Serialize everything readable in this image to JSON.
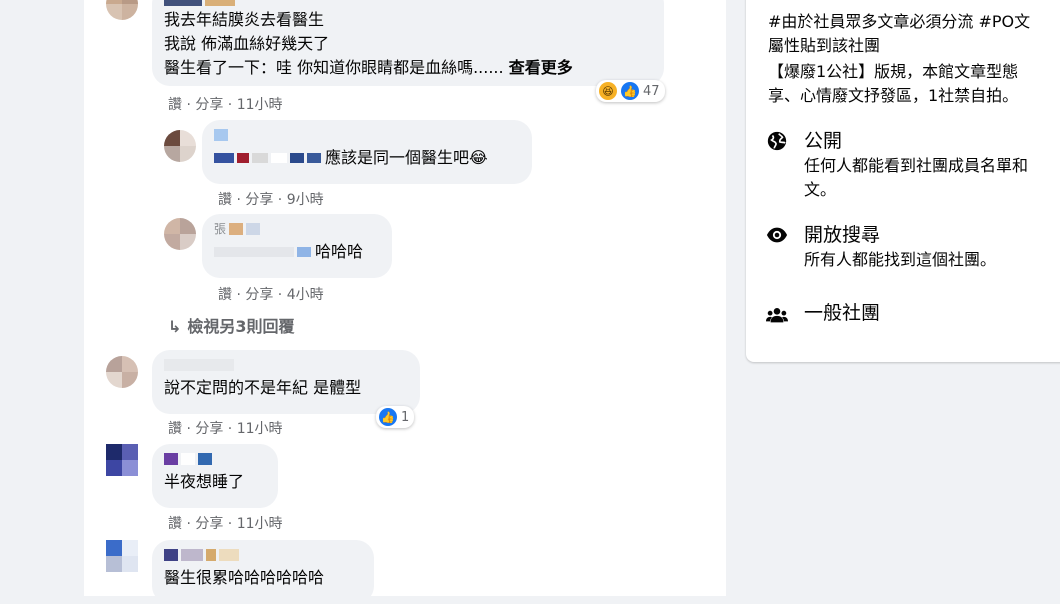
{
  "comments": [
    {
      "lines": [
        "我去年結膜炎去看醫生",
        "我說 佈滿血絲好幾天了",
        "醫生看了一下：哇 你知道你眼睛都是血絲嗎......"
      ],
      "see_more": "查看更多",
      "actions": "讚 · 分享 · 11小時",
      "reaction_count": "47"
    },
    {
      "text": "應該是同一個醫生吧",
      "emoji": "😂",
      "actions": "讚 · 分享 · 9小時"
    },
    {
      "name_hint": "張",
      "text": "哈哈哈",
      "actions": "讚 · 分享 · 4小時"
    },
    {
      "text": "說不定問的不是年紀 是體型",
      "actions": "讚 · 分享 · 11小時",
      "reaction_count": "1"
    },
    {
      "text": "半夜想睡了",
      "actions": "讚 · 分享 · 11小時"
    },
    {
      "text": "醫生很累哈哈哈哈哈哈"
    }
  ],
  "more_replies": "檢視另3則回覆",
  "about": {
    "desc_lines": [
      "#由於社員眾多文章必須分流 #PO文",
      "屬性貼到該社團",
      "【爆廢1公社】版規，本館文章型態",
      "享、心情廢文抒發區，1社禁自拍。"
    ],
    "public_title": "公開",
    "public_desc_1": "任何人都能看到社團成員名單和",
    "public_desc_2": "文。",
    "visible_title": "開放搜尋",
    "visible_desc": "所有人都能找到這個社團。",
    "general_title": "一般社團"
  },
  "colors": {
    "accent": "#1877f2",
    "bubble": "#f0f2f5",
    "muted": "#65676b"
  },
  "icons": {
    "public": "globe-icon",
    "visible": "eye-icon",
    "general": "people-icon",
    "reply": "reply-arrow-icon"
  }
}
